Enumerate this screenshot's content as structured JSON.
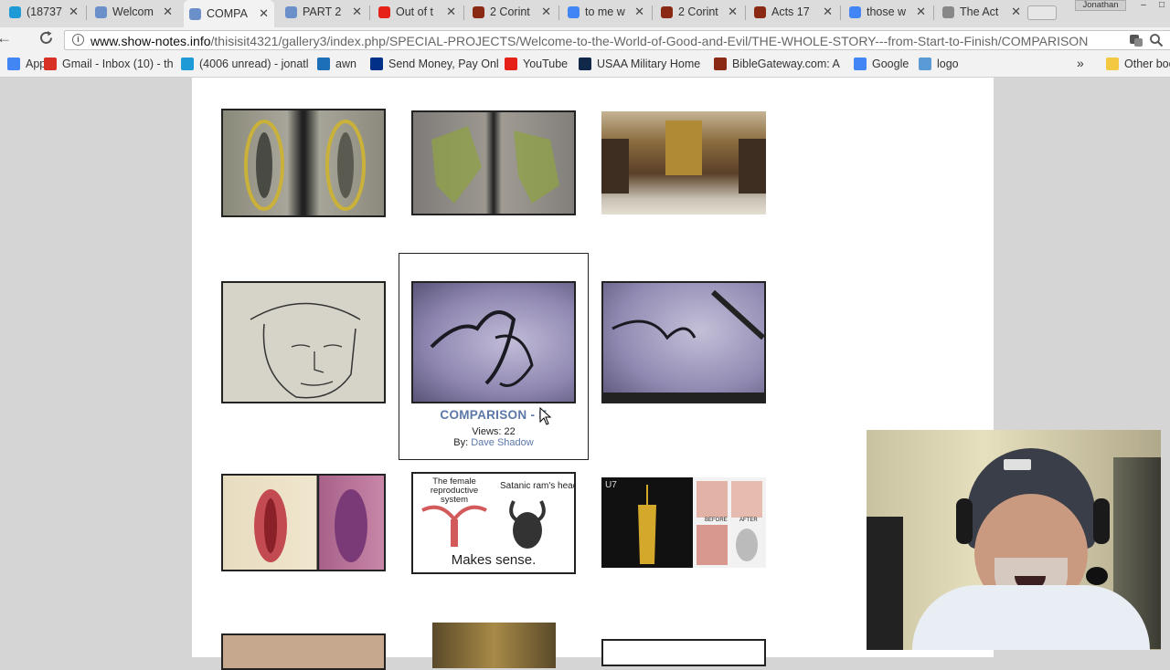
{
  "tabs": [
    {
      "title": "(18737",
      "icon": "at-t-globe-icon",
      "color": "#1e9bd7"
    },
    {
      "title": "Welcom",
      "icon": "gallery-icon",
      "color": "#6b8fc9"
    },
    {
      "title": "COMPA",
      "icon": "gallery-icon",
      "color": "#6b8fc9",
      "active": true
    },
    {
      "title": "PART 2",
      "icon": "gallery-icon",
      "color": "#6b8fc9"
    },
    {
      "title": "Out of t",
      "icon": "youtube-icon",
      "color": "#e62117"
    },
    {
      "title": "2 Corint",
      "icon": "biblegateway-icon",
      "color": "#8b2a14"
    },
    {
      "title": "to me w",
      "icon": "google-icon",
      "color": "#4285f4"
    },
    {
      "title": "2 Corint",
      "icon": "biblegateway-icon",
      "color": "#8b2a14"
    },
    {
      "title": "Acts 17",
      "icon": "biblegateway-icon",
      "color": "#8b2a14"
    },
    {
      "title": "those w",
      "icon": "google-icon",
      "color": "#4285f4"
    },
    {
      "title": "The Act",
      "icon": "document-icon",
      "color": "#888888"
    }
  ],
  "user_badge": "Jonathan",
  "window_controls": {
    "minimize": "–",
    "restore": "□"
  },
  "url": {
    "domain": "www.show-notes.info",
    "path": "/thisisit4321/gallery3/index.php/SPECIAL-PROJECTS/Welcome-to-the-World-of-Good-and-Evil/THE-WHOLE-STORY---from-Start-to-Finish/COMPARISON"
  },
  "bookmarks": [
    {
      "label": "Apps",
      "icon": "apps-grid-icon",
      "color": "#4285f4"
    },
    {
      "label": "Gmail - Inbox (10) - th",
      "icon": "gmail-icon",
      "color": "#d93025"
    },
    {
      "label": "(4006 unread) - jonatl",
      "icon": "at-t-globe-icon",
      "color": "#1e9bd7"
    },
    {
      "label": "awn",
      "icon": "awn-icon",
      "color": "#1d6fb8"
    },
    {
      "label": "Send Money, Pay Onl",
      "icon": "paypal-icon",
      "color": "#003087"
    },
    {
      "label": "YouTube",
      "icon": "youtube-icon",
      "color": "#e62117"
    },
    {
      "label": "USAA Military Home",
      "icon": "usaa-icon",
      "color": "#12284b"
    },
    {
      "label": "BibleGateway.com: A",
      "icon": "biblegateway-icon",
      "color": "#8b2a14"
    },
    {
      "label": "Google",
      "icon": "google-icon",
      "color": "#4285f4"
    },
    {
      "label": "logo",
      "icon": "logo-icon",
      "color": "#5b9bd5"
    }
  ],
  "bookmarks_overflow": "»",
  "other_bookmarks": "Other boo",
  "gallery": {
    "hover_caption": {
      "title": "COMPARISON - E",
      "views": "Views: 22",
      "by_label": "By:",
      "by_user": "Dave Shadow"
    },
    "image_texts": {
      "female": "The female reproductive system",
      "ram": "Satanic ram's head",
      "makes_sense": "Makes sense.",
      "u7": "U7",
      "before": "BEFORE",
      "after": "AFTER"
    }
  }
}
